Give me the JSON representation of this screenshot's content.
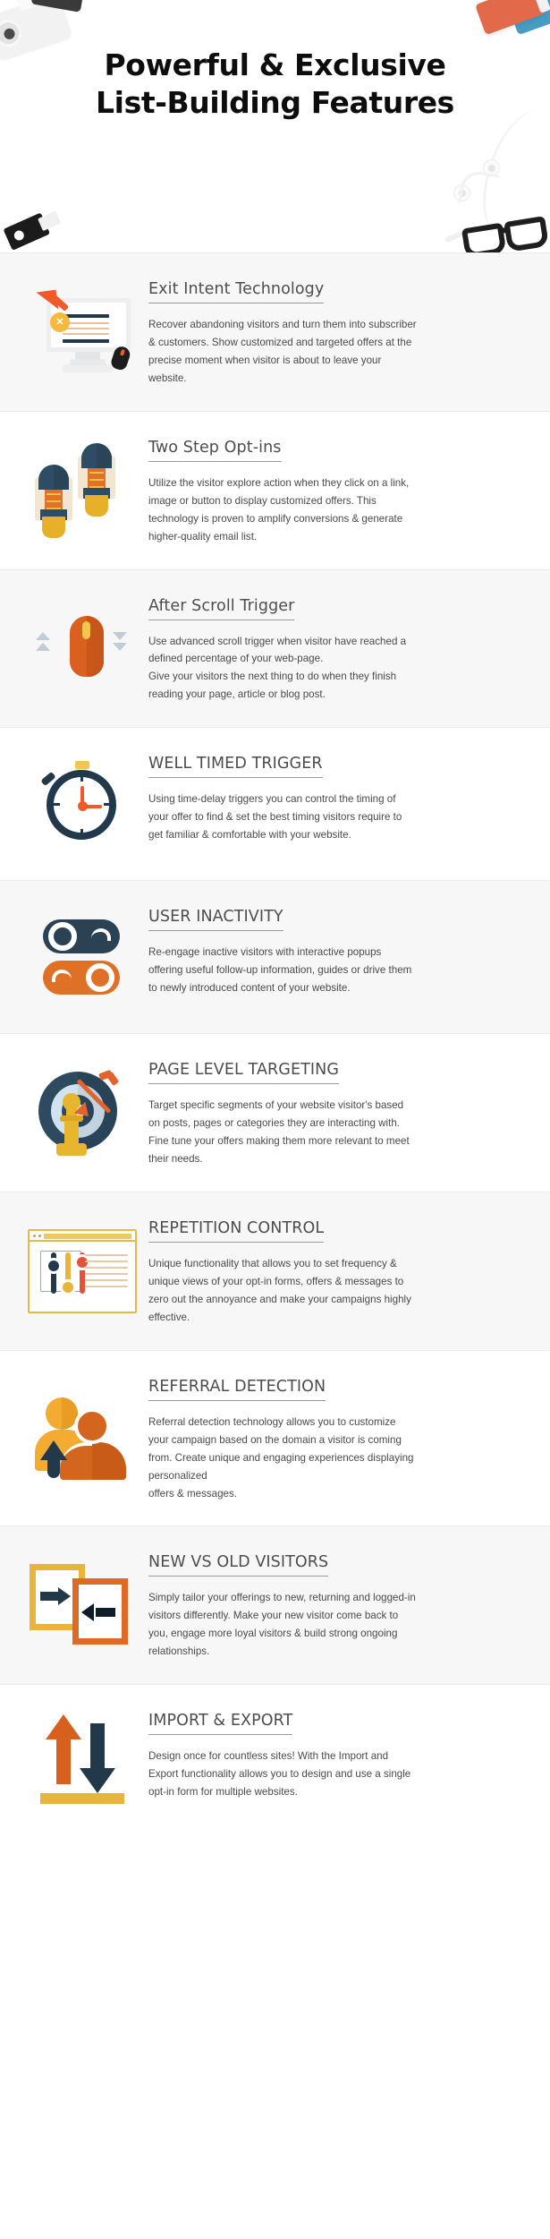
{
  "header": {
    "title_line1": "Powerful & Exclusive",
    "title_line2": "List-Building Features",
    "decor": [
      "camera-icon",
      "eraser-icon",
      "blue-block-icon",
      "usb-drive-icon",
      "earphones-icon",
      "eyeglasses-icon",
      "pen-icon"
    ]
  },
  "features": [
    {
      "id": "exit-intent-technology",
      "title": "Exit Intent Technology",
      "description": "Recover abandoning visitors and turn them into subscriber & customers. Show customized and targeted offers at the precise moment when visitor is about to leave your website.",
      "icon": "monitor-exit-arrow-icon",
      "background": "#f7f7f7"
    },
    {
      "id": "two-step-opt-ins",
      "title": "Two Step Opt-ins",
      "description": "Utilize the visitor explore action when they click on a link, image or button to display customized offers. This technology is proven to amplify conversions & generate higher-quality email list.",
      "icon": "sneakers-icon",
      "background": "#ffffff"
    },
    {
      "id": "after-scroll-trigger",
      "title": "After Scroll Trigger",
      "description": "Use advanced scroll trigger when visitor have reached a defined percentage of your web-page.\nGive your visitors the next thing to do when they finish reading your page, article or blog post.",
      "icon": "scroll-mouse-icon",
      "background": "#f7f7f7"
    },
    {
      "id": "well-timed-trigger",
      "title": "WELL TIMED TRIGGER",
      "description": "Using time-delay triggers you can control the timing of your offer to find & set the best timing visitors require to get familiar & comfortable with your website.",
      "icon": "stopwatch-icon",
      "background": "#ffffff"
    },
    {
      "id": "user-inactivity",
      "title": "USER INACTIVITY",
      "description": "Re-engage inactive visitors with interactive popups offering useful follow-up information, guides or drive them to newly introduced content of your website.",
      "icon": "toggle-switches-icon",
      "background": "#f7f7f7"
    },
    {
      "id": "page-level-targeting",
      "title": "PAGE LEVEL TARGETING",
      "description": "Target specific segments of your website visitor's based on posts, pages or categories they are interacting with. Fine tune your offers making them more relevant to meet their needs.",
      "icon": "target-arrow-icon",
      "background": "#ffffff"
    },
    {
      "id": "repetition-control",
      "title": "REPETITION CONTROL",
      "description": "Unique functionality that allows you to set frequency & unique views of your opt-in forms, offers & messages to zero out the annoyance and make your campaigns highly effective.",
      "icon": "browser-sliders-icon",
      "background": "#f7f7f7"
    },
    {
      "id": "referral-detection",
      "title": "REFERRAL DETECTION",
      "description": "Referral detection technology allows you to customize your campaign based on the domain a visitor is coming from. Create unique and engaging experiences displaying personalized\noffers & messages.",
      "icon": "people-referral-icon",
      "background": "#ffffff"
    },
    {
      "id": "new-vs-old-visitors",
      "title": "NEW VS OLD VISITORS",
      "description": "Simply tailor your offerings to new, returning and logged-in visitors differently. Make your new visitor come back to you, engage more loyal visitors & build strong ongoing relationships.",
      "icon": "two-cards-arrows-icon",
      "background": "#f7f7f7"
    },
    {
      "id": "import-and-export",
      "title": "IMPORT & EXPORT",
      "description": "Design once for countless sites! With the Import and Export functionality allows you to design and use a single opt-in form for multiple websites.",
      "icon": "import-export-arrows-icon",
      "background": "#ffffff"
    }
  ],
  "colors": {
    "orange": "#de6a25",
    "dark_navy": "#22384b",
    "yellow": "#e8b43b",
    "light_blue": "#cfe4f0",
    "alt_row_bg": "#f7f7f7",
    "text": "#4a4a4a",
    "title_text": "#4d4d4d"
  }
}
